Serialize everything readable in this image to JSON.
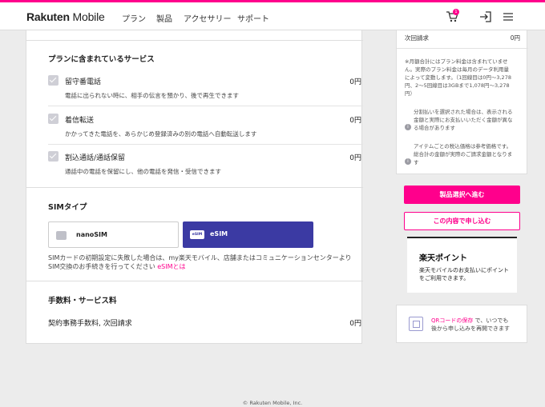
{
  "header": {
    "logo_brand": "Rakuten",
    "logo_product": "Mobile",
    "nav": [
      "プラン",
      "製品",
      "アクセサリー",
      "サポート"
    ],
    "cart_count": "1"
  },
  "plan_services": {
    "title": "プランに含まれているサービス",
    "items": [
      {
        "name": "留守番電話",
        "price": "0円",
        "desc": "電話に出られない時に、相手の伝言を預かり、後で再生できます"
      },
      {
        "name": "着信転送",
        "price": "0円",
        "desc": "かかってきた電話を、あらかじめ登録済みの別の電話へ自動転送します"
      },
      {
        "name": "割込通話/通話保留",
        "price": "0円",
        "desc": "通話中の電話を保留にし、他の電話を発信・受信できます"
      }
    ]
  },
  "sim": {
    "title": "SIMタイプ",
    "options": [
      {
        "label": "nanoSIM",
        "selected": false
      },
      {
        "label": "eSIM",
        "chip_text": "eSIM",
        "selected": true
      }
    ],
    "note_line1": "SIMカードの初期設定に失敗した場合は、my楽天モバイル、店舗またはコミュニケーションセンターより",
    "note_line2": "SIM交換のお手続きを行ってください",
    "note_link": "eSIMとは"
  },
  "fees": {
    "title": "手数料・サービス料",
    "item": "契約事務手数料, 次回請求",
    "price": "0円"
  },
  "summary": {
    "next_bill_label": "次回請求",
    "next_bill_value": "0円",
    "note_lines": [
      "※月額合計にはプラン料金は含まれていませ",
      "ん。実際のプラン料金は毎月のデータ利用量",
      "によって変動します。（1回線目は0円〜3,278",
      "円、2〜5回線目は3GBまで1,078円〜3,278",
      "円）"
    ],
    "info1_lines": [
      "分割払いを選択された場合は、表示される",
      "金額と実際にお支払いいただく金額が異な",
      "る場合があります"
    ],
    "info2_lines": [
      "アイテムごとの税込価格は参考価格です。",
      "総合計の金額が実際のご請求金額となりま",
      "す"
    ],
    "primary_button": "製品選択へ進む",
    "secondary_button": "この内容で申し込む"
  },
  "points": {
    "title": "楽天ポイント",
    "desc_line1": "楽天モバイルのお支払いにポイント",
    "desc_line2": "をご利用できます。"
  },
  "qr": {
    "link": "QRコードの保存",
    "text_rest": "で、いつでも",
    "text_line2": "後から申し込みを再開できます"
  },
  "footer": {
    "copyright": "© Rakuten Mobile, Inc."
  },
  "colors": {
    "brand": "#ff008c",
    "esim_selected": "#3b3aa3"
  }
}
